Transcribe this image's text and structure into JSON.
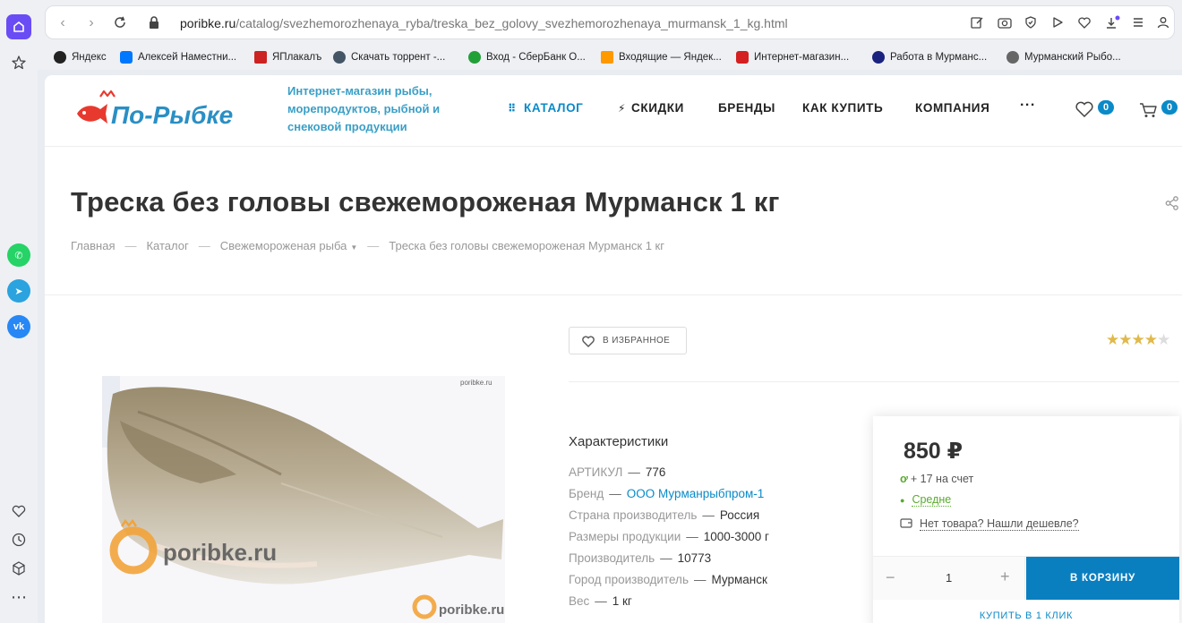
{
  "browser": {
    "url_host": "poribke.ru",
    "url_path": "/catalog/svezhemorozhenaya_ryba/treska_bez_golovy_svezhemorozhenaya_murmansk_1_kg.html",
    "bookmarks": [
      {
        "label": "Яндекс",
        "icon": "yandex-icon",
        "color": "#222222"
      },
      {
        "label": "Алексей Наместни...",
        "icon": "vk-icon",
        "color": "#0077ff"
      },
      {
        "label": "ЯПлакалъ",
        "icon": "yaplakal-icon",
        "color": "#cc2222"
      },
      {
        "label": "Скачать торрент -...",
        "icon": "binoculars-icon",
        "color": "#445566"
      },
      {
        "label": "Вход - СберБанк О...",
        "icon": "sber-icon",
        "color": "#21a038"
      },
      {
        "label": "Входящие — Яндек...",
        "icon": "mail-icon",
        "color": "#ff9900"
      },
      {
        "label": "Интернет-магазин...",
        "icon": "shop-icon",
        "color": "#d42020"
      },
      {
        "label": "Работа в Мурманс...",
        "icon": "hh-icon",
        "color": "#1a237e"
      },
      {
        "label": "Мурманский Рыбо...",
        "icon": "fish-site-icon",
        "color": "#666666"
      }
    ]
  },
  "header": {
    "logo_text": "По-Рыбке",
    "slogan": "Интернет-магазин рыбы, морепродуктов, рыбной и снековой продукции",
    "menu": [
      {
        "label": "КАТАЛОГ",
        "active": true
      },
      {
        "label": "СКИДКИ",
        "active": false
      },
      {
        "label": "БРЕНДЫ",
        "active": false
      },
      {
        "label": "КАК КУПИТЬ",
        "active": false
      },
      {
        "label": "КОМПАНИЯ",
        "active": false
      }
    ],
    "more": "···",
    "favorites_count": "0",
    "cart_count": "0"
  },
  "product": {
    "title": "Треска без головы свежемороженая Мурманск 1 кг",
    "breadcrumbs": [
      "Главная",
      "Каталог",
      "Свежемороженая рыба",
      "Треска без головы свежемороженая Мурманск 1 кг"
    ],
    "favorite_label": "В ИЗБРАННОЕ",
    "rating": 4,
    "rating_max": 5,
    "photo_watermark": "poribke.ru",
    "characteristics_title": "Характеристики",
    "specs": [
      {
        "key": "АРТИКУЛ",
        "value": "776",
        "link": false
      },
      {
        "key": "Бренд",
        "value": "ООО Мурманрыбпром-1",
        "link": true
      },
      {
        "key": "Страна производитель",
        "value": "Россия",
        "link": false
      },
      {
        "key": "Размеры продукции",
        "value": "1000-3000 г",
        "link": false
      },
      {
        "key": "Производитель",
        "value": "10773",
        "link": false
      },
      {
        "key": "Город производитель",
        "value": "Мурманск",
        "link": false
      },
      {
        "key": "Вес",
        "value": "1 кг",
        "link": false
      }
    ],
    "dash": "—"
  },
  "buy": {
    "price": "850 ₽",
    "bonus": "+ 17 на счет",
    "stock": "Средне",
    "cheaper": "Нет товара? Нашли дешевле?",
    "qty_minus": "−",
    "qty": "1",
    "qty_plus": "+",
    "cart_button": "В КОРЗИНУ",
    "one_click": "КУПИТЬ В 1 КЛИК"
  },
  "colors": {
    "accent": "#0a7fc0",
    "slogan": "#3a9fc6",
    "logo_red": "#e8392e",
    "logo_blue": "#2a8fc4",
    "star": "#e0b94a",
    "stock_green": "#5aab2e"
  }
}
